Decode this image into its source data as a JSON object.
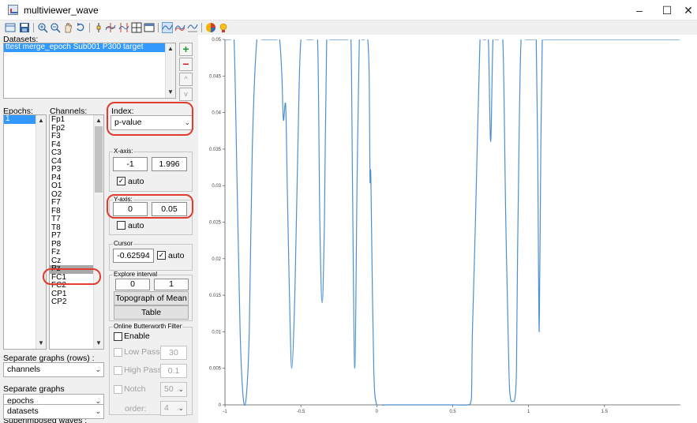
{
  "window": {
    "title": "multiviewer_wave",
    "minimize_glyph": "–",
    "maximize_glyph": "☐",
    "close_glyph": "✕"
  },
  "toolbar": {
    "icons": [
      "open-icon",
      "save-icon",
      "zoom-in-icon",
      "zoom-out-icon",
      "pan-icon",
      "rotate-icon",
      "datacursor-icon",
      "channel-layout-icon",
      "event-layout-icon",
      "grid-icon",
      "window-icon",
      "wave-icon-1",
      "wave-icon-2",
      "wave-icon-3",
      "color-icon",
      "bulb-icon"
    ]
  },
  "datasets": {
    "label": "Datasets:",
    "items": [
      "ttest merge_epoch Sub001 P300 target"
    ],
    "add_glyph": "+",
    "remove_glyph": "−",
    "up_glyph": "^",
    "down_glyph": "v"
  },
  "epochs": {
    "label": "Epochs:",
    "items": [
      "1"
    ]
  },
  "channels": {
    "label": "Channels:",
    "items": [
      "Fp1",
      "Fp2",
      "F3",
      "F4",
      "C3",
      "C4",
      "P3",
      "P4",
      "O1",
      "O2",
      "F7",
      "F8",
      "T7",
      "T8",
      "P7",
      "P8",
      "Fz",
      "Cz",
      "Pz",
      "FC1",
      "FC2",
      "CP1",
      "CP2"
    ],
    "selected": "Pz"
  },
  "index": {
    "label": "Index:",
    "value": "p-value"
  },
  "xaxis": {
    "title": "X-axis:",
    "min": "-1",
    "max": "1.996",
    "auto_label": "auto",
    "auto_checked": true
  },
  "yaxis": {
    "title": "Y-axis:",
    "min": "0",
    "max": "0.05",
    "auto_label": "auto",
    "auto_checked": false
  },
  "cursor": {
    "title": "Cursor",
    "value": "-0.62594",
    "auto_label": "auto",
    "auto_checked": true
  },
  "explore": {
    "title": "Explore interval",
    "start": "0",
    "end": "1",
    "topograph_label": "Topograph of Mean",
    "table_label": "Table"
  },
  "filter": {
    "title": "Online Butterworth Filter",
    "enable_label": "Enable",
    "lowpass_label": "Low Pass",
    "lowpass_value": "30",
    "highpass_label": "High Pass",
    "highpass_value": "0.1",
    "notch_label": "Notch",
    "notch_value": "50",
    "order_label": "order:",
    "order_value": "4"
  },
  "graph_options": {
    "rows_label": "Separate graphs (rows) :",
    "rows_value": "channels",
    "graphs_label": "Separate graphs",
    "graphs_value": "epochs",
    "superimposed_label": "Superimposed waves :",
    "superimposed_value": "datasets"
  },
  "colors": {
    "line": "#4a90d0",
    "highlight": "#e03c2f",
    "selection": "#3399ff"
  },
  "chart_data": {
    "type": "line",
    "title": "",
    "xlabel": "",
    "ylabel": "",
    "xlim": [
      -1,
      2
    ],
    "ylim": [
      0,
      0.05
    ],
    "x_ticks": [
      "-1",
      "-0.5",
      "0",
      "0.5",
      "1",
      "1.5"
    ],
    "y_ticks": [
      "0",
      "0.005",
      "0.01",
      "0.015",
      "0.02",
      "0.025",
      "0.03",
      "0.035",
      "0.04",
      "0.045",
      "0.05"
    ],
    "series": [
      {
        "name": "",
        "x": [
          -1.0,
          -0.98,
          -0.96,
          -0.94,
          -0.92,
          -0.9,
          -0.88,
          -0.86,
          -0.84,
          -0.82,
          -0.79,
          -0.76,
          -0.74,
          -0.71,
          -0.69,
          -0.66,
          -0.64,
          -0.625,
          -0.615,
          -0.6,
          -0.59,
          -0.575,
          -0.56,
          -0.54,
          -0.52,
          -0.5,
          -0.46,
          -0.42,
          -0.39,
          -0.375,
          -0.36,
          -0.345,
          -0.33,
          -0.31,
          -0.27,
          -0.23,
          -0.19,
          -0.17,
          -0.16,
          -0.145,
          -0.13,
          -0.115,
          -0.1,
          -0.08,
          -0.06,
          -0.05,
          -0.045,
          -0.04,
          -0.035,
          -0.02,
          0.0,
          0.05,
          0.1,
          0.15,
          0.2,
          0.3,
          0.4,
          0.5,
          0.6,
          0.62,
          0.625,
          0.63,
          0.65,
          0.68,
          0.7,
          0.72,
          0.735,
          0.75,
          0.765,
          0.78,
          0.8,
          0.83,
          0.85,
          0.87,
          0.88,
          0.895,
          0.91,
          0.92,
          0.93,
          0.95,
          0.98,
          1.0,
          1.02,
          1.04,
          1.05,
          1.06,
          1.07,
          1.08,
          1.09,
          1.1,
          1.11,
          1.13,
          1.15,
          1.2,
          1.4,
          1.6,
          1.8,
          1.996
        ],
        "y": [
          0.05,
          0.05,
          0.05,
          0.05,
          0.03,
          0.01,
          0.001,
          0.001,
          0.01,
          0.035,
          0.05,
          0.05,
          0.05,
          0.05,
          0.05,
          0.05,
          0.05,
          0.045,
          0.039,
          0.041,
          0.03,
          0.015,
          0.005,
          0.015,
          0.035,
          0.05,
          0.05,
          0.05,
          0.05,
          0.025,
          0.014,
          0.025,
          0.05,
          0.05,
          0.05,
          0.05,
          0.05,
          0.05,
          0.03,
          0.005,
          0.03,
          0.05,
          0.05,
          0.05,
          0.05,
          0.045,
          0.031,
          0.032,
          0.025,
          0.005,
          0.0,
          0.0,
          0.0,
          0.0,
          0.0,
          0.0,
          0.0,
          0.0,
          0.0,
          0.0005,
          0.002,
          0.01,
          0.025,
          0.05,
          0.05,
          0.05,
          0.05,
          0.036,
          0.05,
          0.05,
          0.05,
          0.05,
          0.025,
          0.005,
          0.001,
          0.0005,
          0.001,
          0.005,
          0.025,
          0.05,
          0.05,
          0.05,
          0.05,
          0.05,
          0.05,
          0.035,
          0.01,
          0.035,
          0.05,
          0.05,
          0.05,
          0.05,
          0.05,
          0.05,
          0.05,
          0.05,
          0.05,
          0.05
        ]
      }
    ]
  }
}
